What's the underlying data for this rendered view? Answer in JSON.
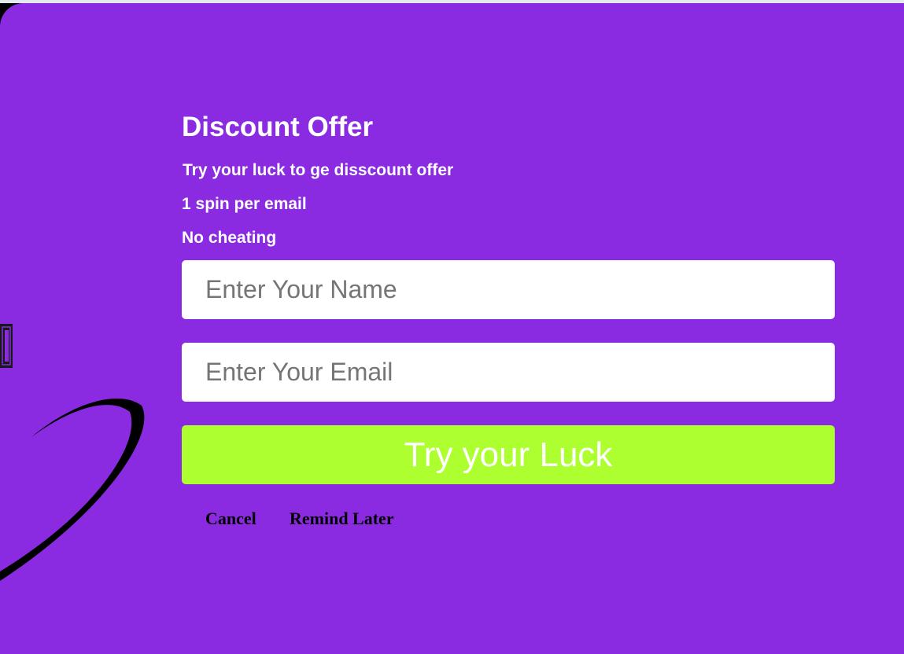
{
  "offer": {
    "title": "Discount Offer",
    "lines": [
      "Try your luck to ge disscount offer",
      "1 spin per email",
      "No cheating"
    ]
  },
  "form": {
    "name_placeholder": "Enter Your Name",
    "email_placeholder": "Enter Your Email",
    "submit_label": "Try your Luck"
  },
  "actions": {
    "cancel_label": "Cancel",
    "remind_label": "Remind Later"
  },
  "colors": {
    "panel_background": "#8a2be2",
    "submit_button": "#adff2f",
    "text": "#ffffff",
    "action_text": "#000000"
  }
}
